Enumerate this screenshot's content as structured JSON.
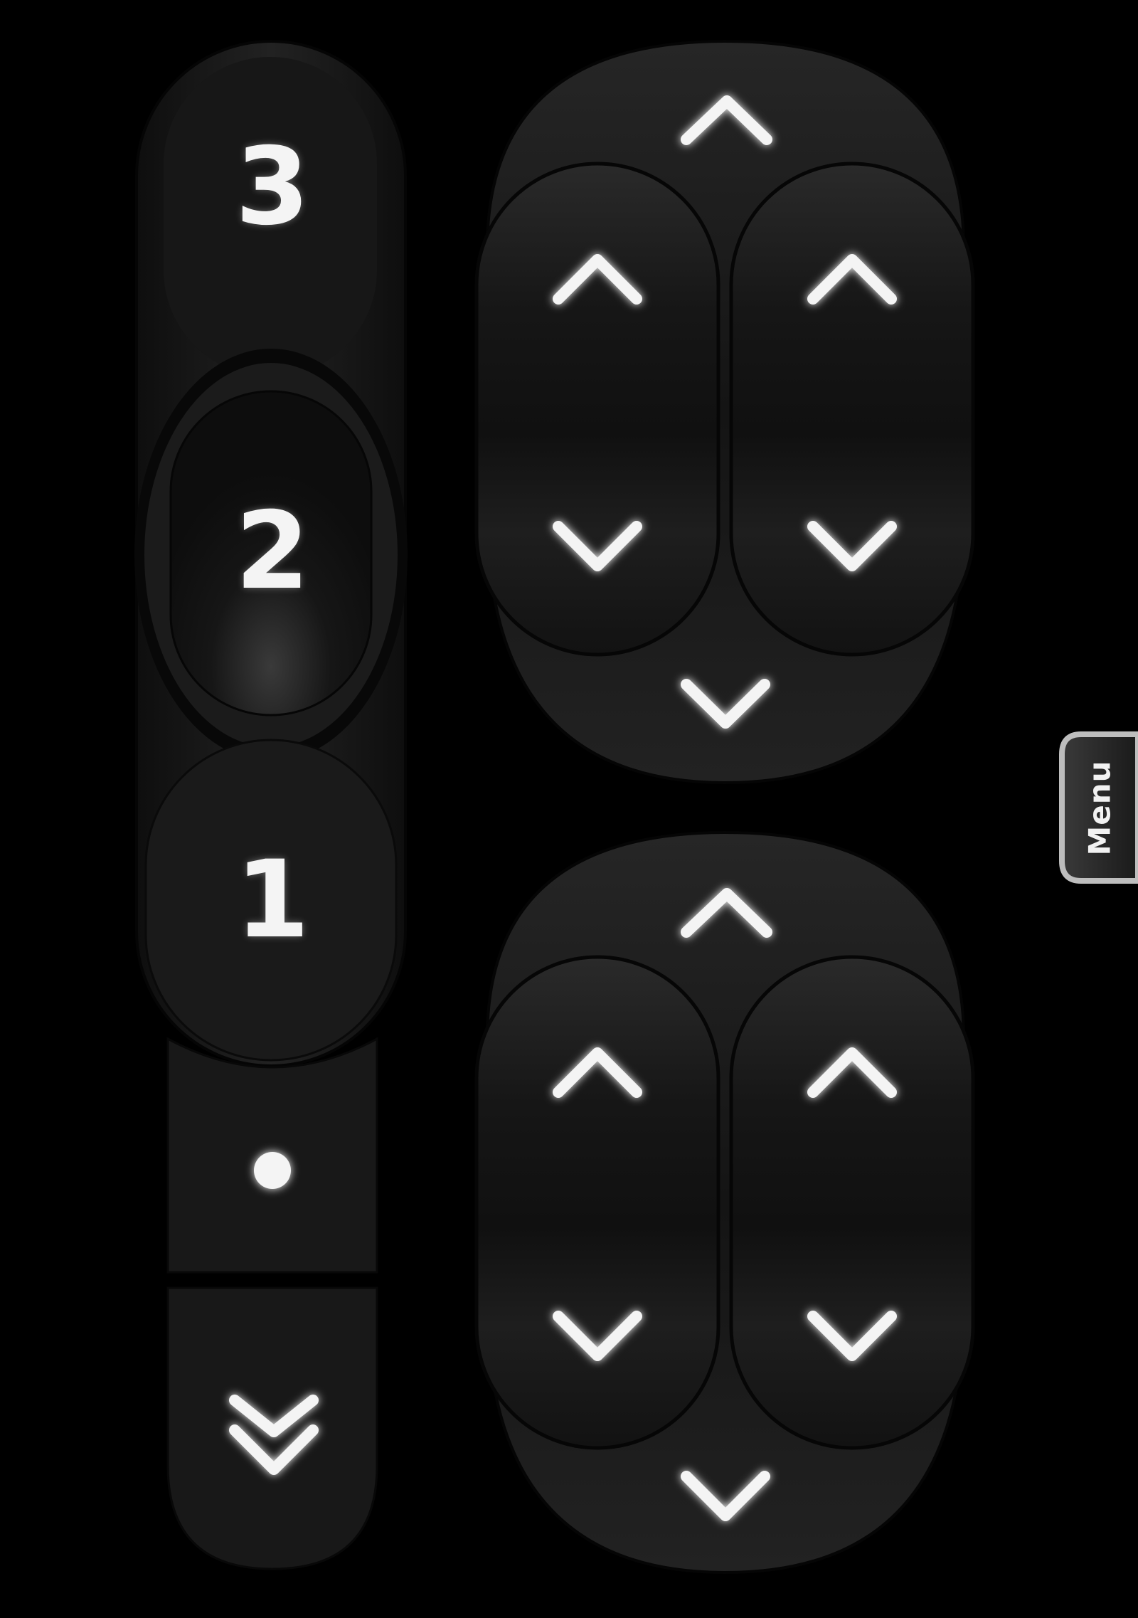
{
  "seat_memory": {
    "position_3_label": "3",
    "position_2_label": "2",
    "position_1_label": "1",
    "set_label_icon": "dot-icon",
    "down_icon": "double-chevron-down-icon",
    "active_position": "2"
  },
  "control_pads": [
    {
      "name": "upper-pad",
      "icons": [
        "chevron-up-icon",
        "chevron-up-icon",
        "chevron-up-icon",
        "chevron-down-icon",
        "chevron-down-icon",
        "chevron-down-icon"
      ]
    },
    {
      "name": "lower-pad",
      "icons": [
        "chevron-up-icon",
        "chevron-up-icon",
        "chevron-up-icon",
        "chevron-down-icon",
        "chevron-down-icon",
        "chevron-down-icon"
      ]
    }
  ],
  "menu_tab": {
    "label": "Menu"
  },
  "colors": {
    "background": "#000000",
    "button": "#1c1c1c",
    "glyph": "#f4f4f4",
    "menu_border": "#bdbdbd"
  }
}
